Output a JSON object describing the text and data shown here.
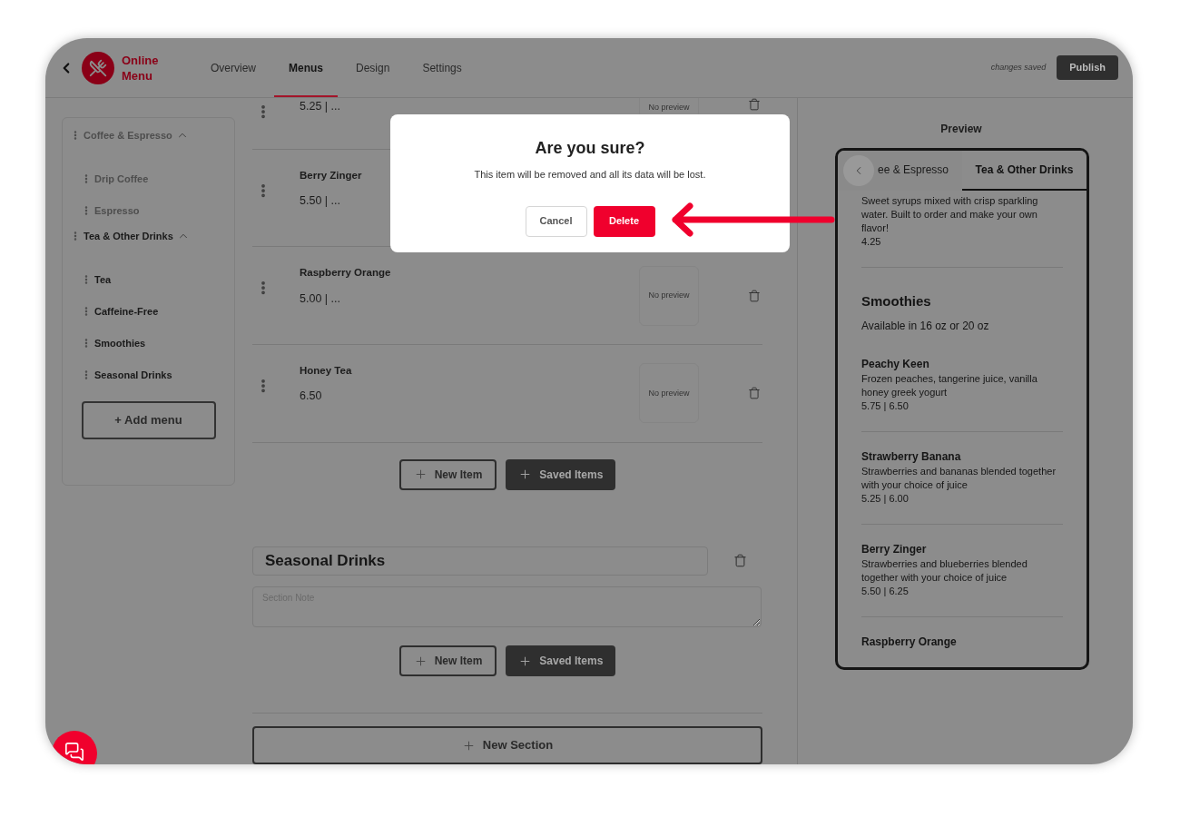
{
  "header": {
    "brand": "Online Menu",
    "tabs": [
      {
        "label": "Overview",
        "selected": false
      },
      {
        "label": "Menus",
        "selected": true
      },
      {
        "label": "Design",
        "selected": false
      },
      {
        "label": "Settings",
        "selected": false
      }
    ],
    "status": "changes saved",
    "publish": "Publish"
  },
  "sidebar": {
    "menus": [
      {
        "label": "Coffee & Espresso",
        "selected": false,
        "expanded": true,
        "children": [
          {
            "label": "Drip Coffee"
          },
          {
            "label": "Espresso"
          }
        ]
      },
      {
        "label": "Tea & Other Drinks",
        "selected": true,
        "expanded": true,
        "children": [
          {
            "label": "Tea"
          },
          {
            "label": "Caffeine-Free"
          },
          {
            "label": "Smoothies"
          },
          {
            "label": "Seasonal Drinks"
          }
        ]
      }
    ],
    "add_menu": "+ Add menu"
  },
  "items": [
    {
      "price": "5.25 | ...",
      "preview": "No preview"
    },
    {
      "name": "Berry Zinger",
      "price": "5.50 | ..."
    },
    {
      "name": "Raspberry Orange",
      "price": "5.00 | ...",
      "preview": "No preview"
    },
    {
      "name": "Honey Tea",
      "price": "6.50",
      "preview": "No preview"
    }
  ],
  "item_buttons": {
    "new_item": "New Item",
    "saved_items": "Saved Items"
  },
  "section": {
    "title": "Seasonal Drinks",
    "note_placeholder": "Section Note",
    "new_item": "New Item",
    "saved_items": "Saved Items"
  },
  "new_section": "New Section",
  "preview": {
    "title": "Preview",
    "tabs": [
      {
        "label": "ee & Espresso",
        "selected": false
      },
      {
        "label": "Tea & Other Drinks",
        "selected": true
      }
    ],
    "entries": [
      {
        "kind": "item",
        "description": "Sweet syrups mixed with crisp sparkling water. Built to order and make your own flavor!",
        "price": "4.25"
      },
      {
        "kind": "section",
        "title": "Smoothies",
        "note": "Available in 16 oz or 20 oz"
      },
      {
        "kind": "item",
        "name": "Peachy Keen",
        "description": "Frozen peaches, tangerine juice, vanilla honey greek yogurt",
        "price": "5.75 | 6.50"
      },
      {
        "kind": "item",
        "name": "Strawberry Banana",
        "description": "Strawberries and bananas blended together with your choice of juice",
        "price": "5.25 | 6.00"
      },
      {
        "kind": "item",
        "name": "Berry Zinger",
        "description": "Strawberries and blueberries blended together with your choice of juice",
        "price": "5.50 | 6.25"
      },
      {
        "kind": "item",
        "name": "Raspberry Orange"
      }
    ]
  },
  "dialog": {
    "title": "Are you sure?",
    "message": "This item will be removed and all its data will be lost.",
    "cancel": "Cancel",
    "delete": "Delete"
  }
}
